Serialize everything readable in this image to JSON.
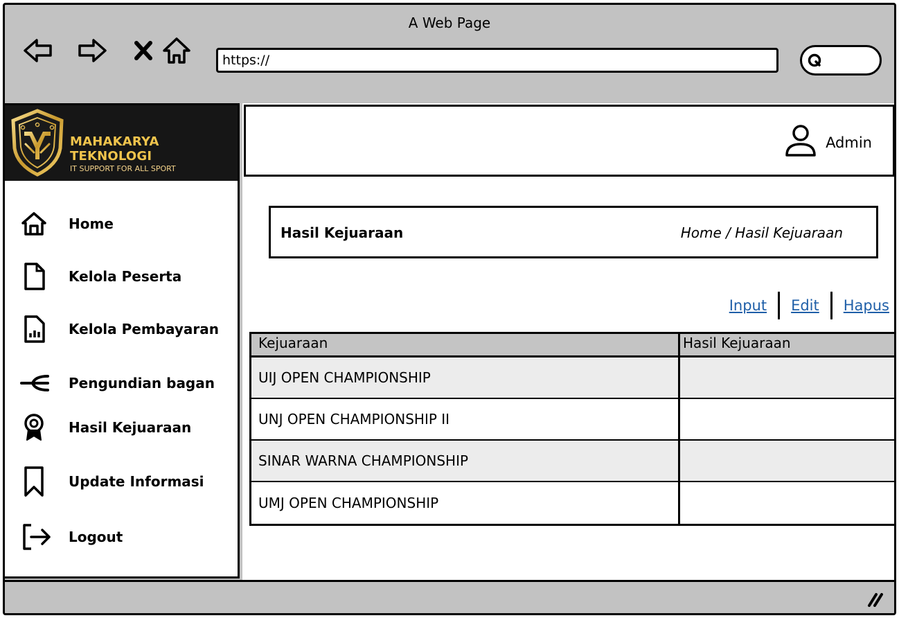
{
  "window": {
    "title": "A Web Page",
    "address": "https://"
  },
  "brand": {
    "name": "MAHAKARYA TEKNOLOGI",
    "tagline": "IT SUPPORT FOR ALL SPORT"
  },
  "sidebar": {
    "items": [
      {
        "label": "Home",
        "icon": "home-icon"
      },
      {
        "label": "Kelola Peserta",
        "icon": "file-icon"
      },
      {
        "label": "Kelola Pembayaran",
        "icon": "report-icon"
      },
      {
        "label": "Pengundian bagan",
        "icon": "bracket-icon"
      },
      {
        "label": "Hasil Kejuaraan",
        "icon": "award-icon"
      },
      {
        "label": "Update Informasi",
        "icon": "bookmark-icon"
      },
      {
        "label": "Logout",
        "icon": "logout-icon"
      }
    ]
  },
  "topbar": {
    "user": "Admin"
  },
  "page": {
    "title": "Hasil Kejuaraan",
    "breadcrumb": "Home / Hasil Kejuaraan"
  },
  "actions": {
    "input": "Input",
    "edit": "Edit",
    "delete": "Hapus"
  },
  "table": {
    "headers": [
      "Kejuaraan",
      "Hasil Kejuaraan"
    ],
    "rows": [
      [
        "UIJ OPEN CHAMPIONSHIP",
        ""
      ],
      [
        "UNJ OPEN CHAMPIONSHIP II",
        ""
      ],
      [
        "SINAR WARNA CHAMPIONSHIP",
        ""
      ],
      [
        "UMJ OPEN CHAMPIONSHIP",
        ""
      ]
    ]
  },
  "colors": {
    "chrome": "#c2c2c2",
    "brand_gold": "#f0c44c",
    "link": "#1f5fa8",
    "table_header": "#c4c4c4"
  }
}
